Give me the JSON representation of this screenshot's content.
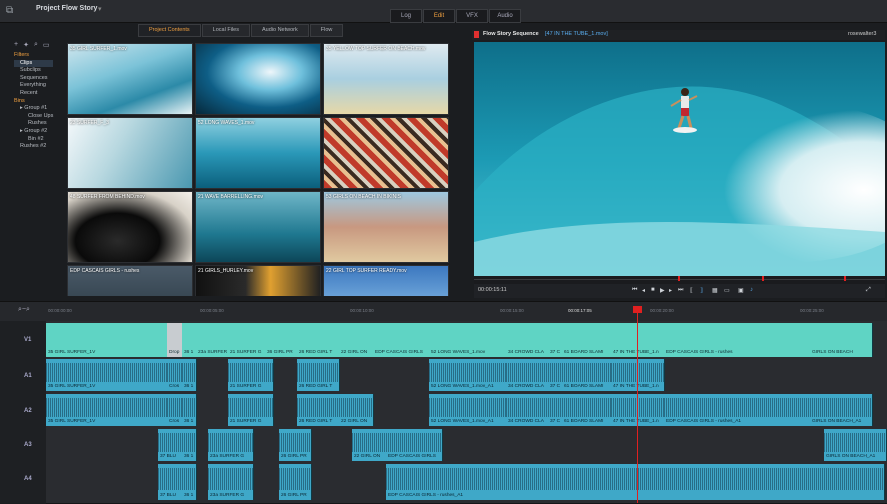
{
  "app": {
    "title": "Project Flow Story",
    "mode_tabs": [
      "Log",
      "Edit",
      "VFX",
      "Audio"
    ],
    "active_mode": "Edit"
  },
  "left_panel": {
    "filters_header": "Filters",
    "filters": [
      "Clips",
      "Subclips",
      "Sequences",
      "Everything",
      "Recent"
    ],
    "bins_header": "Bins",
    "bins": [
      {
        "label": "Group #1",
        "level": 1
      },
      {
        "label": "Close Ups",
        "level": 2
      },
      {
        "label": "Rushes",
        "level": 2
      },
      {
        "label": "Group #2",
        "level": 1
      },
      {
        "label": "Bin #2",
        "level": 2
      },
      {
        "label": "Rushes #2",
        "level": 1
      }
    ]
  },
  "browser": {
    "tabs": [
      "Project Contents",
      "Local Files",
      "Audio Network",
      "Flow"
    ],
    "active_tab": "Project Contents",
    "thumbnails": [
      {
        "caption": "35 GIRL SURFER_1.mov"
      },
      {
        "caption": ""
      },
      {
        "caption": "35 YELLOW TOP SURFER ON BEACH.mov"
      },
      {
        "caption": "23 SURFER_F_3"
      },
      {
        "caption": "52 LONG WAVES_1.mov"
      },
      {
        "caption": ""
      },
      {
        "caption": "48 SURFER FROM BEHIND.mov"
      },
      {
        "caption": "21 WAVE BARRELLING.mov"
      },
      {
        "caption": "53 GIRLS ON BEACH IN BIKINIS"
      },
      {
        "caption": "EDP CASCAIS GIRLS - rushes"
      },
      {
        "caption": "21 GIRLS_HURLEY.mov"
      },
      {
        "caption": "22 GIRL TOP SURFER READY.mov"
      }
    ]
  },
  "viewer": {
    "sequence": "Flow Story Sequence",
    "clip": "[47 IN THE TUBE_1.mov]",
    "user": "rosewalter3",
    "timecode": "00:00:15:11"
  },
  "timeline": {
    "ruler": [
      "00:00:00:00",
      "00:00:05:00",
      "00:00:10:00",
      "00:00:15:00",
      "00:00:17:05",
      "00:00:20:00",
      "00:00:25:00"
    ],
    "tracks": [
      "V1",
      "A1",
      "A2",
      "A3",
      "A4"
    ],
    "v1_clips": [
      "35 GIRL SURFER_1V",
      "Drop",
      "36 1",
      "23a SURFER",
      "21 SURFER G",
      "36 GIRL PR",
      "26 RED GIRL T",
      "22 GIRL ON",
      "EDP CASCAIS GIRLS",
      "52 LONG WAVES_1.mov",
      "34 CROWD CLA",
      "37 C",
      "61 BOARD SLAMI",
      "47 IN THE TUBE_1.n",
      "EDP CASCAIS GIRLS - rushes",
      "GIRLS ON BEACH"
    ],
    "a1_clips": [
      "35 GIRL SURFER_1V",
      "Cros",
      "36 1",
      "21 SURFER G",
      "26 RED GIRL T",
      "52 LONG WAVES_1.mov_A1",
      "34 CROWD CLA",
      "37 C",
      "61 BOARD SLAMI",
      "47 IN THE TUBE_1.n"
    ],
    "a2_clips": [
      "35 GIRL SURFER_1V",
      "Cros",
      "36 1",
      "21 SURFER G",
      "26 RED GIRL T",
      "22 GIRL ON",
      "52 LONG WAVES_1.mov_A1",
      "34 CROWD CLA",
      "37 C",
      "61 BOARD SLAMI",
      "47 IN THE TUBE_1.n",
      "EDP CASCAIS GIRLS - rushes_A1",
      "GIRLS ON BEACH_A1"
    ],
    "a3_clips": [
      "37 BLU",
      "36 1",
      "23a SURFER G",
      "26 GIRL PR",
      "22 GIRL ON",
      "EDP CASCAIS GIRLS",
      "GIRLS ON BEACH_A1"
    ],
    "a4_clips": [
      "37 BLU",
      "36 1",
      "23a SURFER G",
      "26 GIRL PR",
      "EDP CASCAIS GIRLS - rushes_A1"
    ]
  }
}
